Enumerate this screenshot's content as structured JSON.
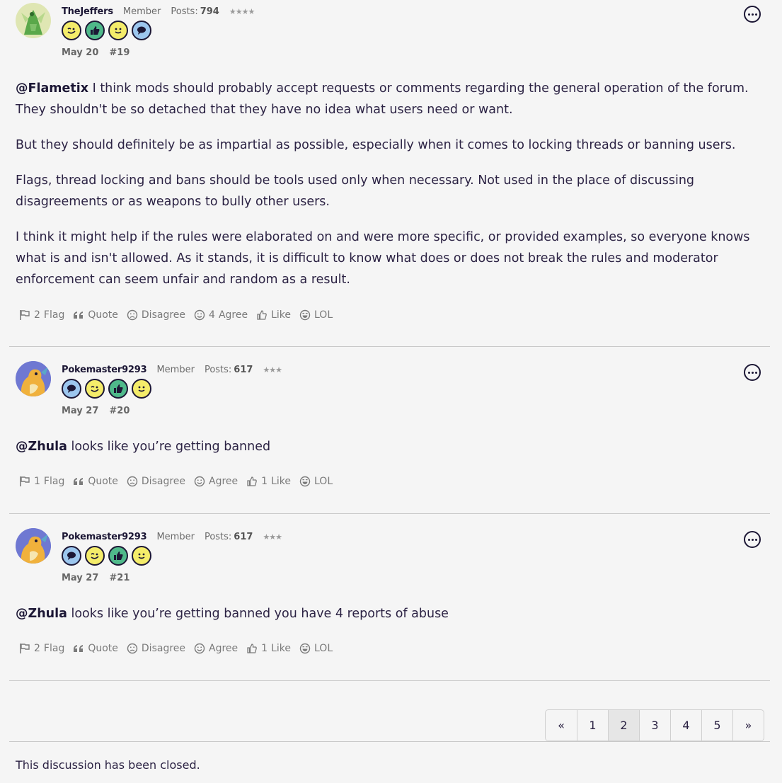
{
  "posts": [
    {
      "username": "TheJeffers",
      "role": "Member",
      "posts_label": "Posts:",
      "posts_count": "794",
      "stars": "★★★★",
      "badges": [
        "wink",
        "thumb",
        "smile",
        "speech"
      ],
      "date": "May 20",
      "number": "#19",
      "avatar": "scyther-avatar",
      "body": [
        {
          "mention": "@Flametix",
          "text": " I think mods should probably accept requests or comments regarding the general operation of the forum. They shouldn't be so detached that they have no idea what users need or want."
        },
        {
          "mention": "",
          "text": "But they should definitely be as impartial as possible, especially when it comes to locking threads or banning users."
        },
        {
          "mention": "",
          "text": "Flags, thread locking and bans should be tools used only when necessary. Not used in the place of discussing disagreements or as weapons to bully other users."
        },
        {
          "mention": "",
          "text": "I think it might help if the rules were elaborated on and were more specific, or provided examples, so everyone knows what is and isn't allowed. As it stands, it is difficult to know what does or does not break the rules and moderator enforcement can seem unfair and random as a result."
        }
      ],
      "reactions": {
        "flag": {
          "count": "2",
          "label": "Flag"
        },
        "quote": {
          "label": "Quote"
        },
        "disagree": {
          "count": "",
          "label": "Disagree"
        },
        "agree": {
          "count": "4",
          "label": "Agree"
        },
        "like": {
          "count": "",
          "label": "Like"
        },
        "lol": {
          "count": "",
          "label": "LOL"
        }
      }
    },
    {
      "username": "Pokemaster9293",
      "role": "Member",
      "posts_label": "Posts:",
      "posts_count": "617",
      "stars": "★★★",
      "badges": [
        "speech",
        "wink",
        "thumb",
        "smile"
      ],
      "date": "May 27",
      "number": "#20",
      "avatar": "dragonite-avatar",
      "body": [
        {
          "mention": "@Zhula",
          "text": " looks like you’re getting banned"
        }
      ],
      "reactions": {
        "flag": {
          "count": "1",
          "label": "Flag"
        },
        "quote": {
          "label": "Quote"
        },
        "disagree": {
          "count": "",
          "label": "Disagree"
        },
        "agree": {
          "count": "",
          "label": "Agree"
        },
        "like": {
          "count": "1",
          "label": "Like"
        },
        "lol": {
          "count": "",
          "label": "LOL"
        }
      }
    },
    {
      "username": "Pokemaster9293",
      "role": "Member",
      "posts_label": "Posts:",
      "posts_count": "617",
      "stars": "★★★",
      "badges": [
        "speech",
        "wink",
        "thumb",
        "smile"
      ],
      "date": "May 27",
      "number": "#21",
      "avatar": "dragonite-avatar",
      "body": [
        {
          "mention": "@Zhula",
          "text": " looks like you’re getting banned you have 4 reports of abuse"
        }
      ],
      "reactions": {
        "flag": {
          "count": "2",
          "label": "Flag"
        },
        "quote": {
          "label": "Quote"
        },
        "disagree": {
          "count": "",
          "label": "Disagree"
        },
        "agree": {
          "count": "",
          "label": "Agree"
        },
        "like": {
          "count": "1",
          "label": "Like"
        },
        "lol": {
          "count": "",
          "label": "LOL"
        }
      }
    }
  ],
  "pagination": {
    "prev": "«",
    "pages": [
      "1",
      "2",
      "3",
      "4",
      "5"
    ],
    "current": "2",
    "next": "»"
  },
  "closed_notice": "This discussion has been closed."
}
